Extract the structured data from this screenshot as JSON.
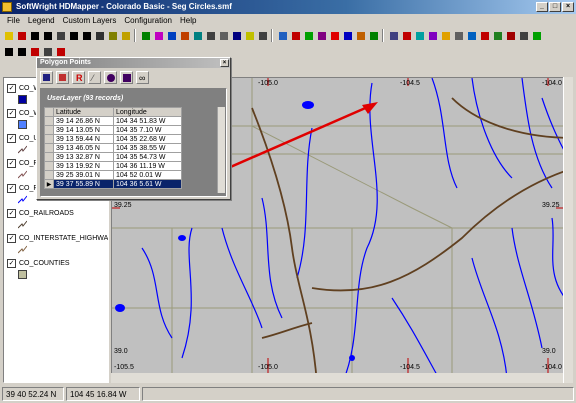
{
  "window": {
    "title": "SoftWright HDMapper - Colorado Basic - Seg Circles.smf"
  },
  "menu": [
    "File",
    "Legend",
    "Custom Layers",
    "Configuration",
    "Help"
  ],
  "legend": {
    "items": [
      {
        "label": "CO_W",
        "color": "#0000a0",
        "style": "fill"
      },
      {
        "label": "CO_W",
        "color": "#5080ff",
        "style": "fill"
      },
      {
        "label": "CO_U",
        "color": "#604040",
        "style": "line"
      },
      {
        "label": "CO_R",
        "color": "#805050",
        "style": "line"
      },
      {
        "label": "CO_R",
        "color": "#0000ff",
        "style": "line"
      },
      {
        "label": "CO_RAILROADS",
        "color": "#504030",
        "style": "line"
      },
      {
        "label": "CO_INTERSTATE_HIGHWAY",
        "color": "#806040",
        "style": "line"
      },
      {
        "label": "CO_COUNTIES",
        "color": "#c0c0a0",
        "style": "fill"
      }
    ]
  },
  "map": {
    "top_labels": [
      "-105.0",
      "-104.5",
      "-104.0"
    ],
    "right_labels": [
      "39.25",
      "39.0"
    ],
    "left_labels": [
      "39.25",
      "39.0"
    ],
    "bottom_labels": [
      "-105.5",
      "-105.0",
      "-104.5",
      "-104.0"
    ],
    "colors": {
      "land": "#c0c0c0",
      "water": "#0000ff",
      "roads": "#604020",
      "counties": "#9a9a7a",
      "arrow": "#e00000"
    }
  },
  "dialog": {
    "title": "Polygon Points",
    "caption": "UserLayer (93 records)",
    "columns": [
      "Latitude",
      "Longitude"
    ],
    "rows": [
      [
        "39 14 26.86 N",
        "104 34 51.83 W"
      ],
      [
        "39 14 13.05 N",
        "104 35 7.10 W"
      ],
      [
        "39 13 59.44 N",
        "104 35 22.68 W"
      ],
      [
        "39 13 46.05 N",
        "104 35 38.55 W"
      ],
      [
        "39 13 32.87 N",
        "104 35 54.73 W"
      ],
      [
        "39 13 19.92 N",
        "104 36 11.19 W"
      ],
      [
        "39 25 39.01 N",
        "104 52 0.01 W"
      ],
      [
        "39 37 55.89 N",
        "104 36 5.61 W"
      ]
    ],
    "selected_row": 7
  },
  "status": {
    "lat": "39 40 52.24 N",
    "lon": "104 45 16.84 W"
  }
}
